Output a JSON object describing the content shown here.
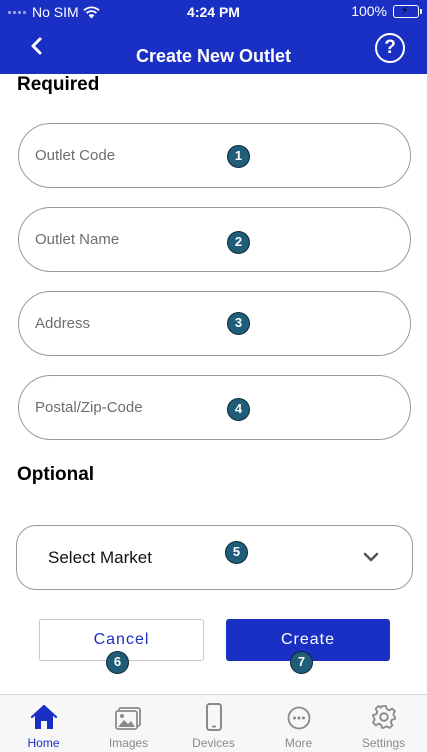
{
  "status_bar": {
    "carrier": "No SIM",
    "time": "4:24 PM",
    "battery": "100%"
  },
  "header": {
    "title": "Create New Outlet",
    "back_icon": "chevron-left-icon",
    "help_icon": "question-circle-icon",
    "help_symbol": "?"
  },
  "required_section": {
    "title": "Required",
    "fields": [
      {
        "placeholder": "Outlet Code",
        "value": "",
        "badge": "1"
      },
      {
        "placeholder": "Outlet Name",
        "value": "",
        "badge": "2"
      },
      {
        "placeholder": "Address",
        "value": "",
        "badge": "3"
      },
      {
        "placeholder": "Postal/Zip-Code",
        "value": "",
        "badge": "4"
      }
    ]
  },
  "optional_section": {
    "title": "Optional",
    "market_select": {
      "label": "Select Market",
      "badge": "5"
    }
  },
  "actions": {
    "cancel_label": "Cancel",
    "cancel_badge": "6",
    "create_label": "Create",
    "create_badge": "7"
  },
  "tabbar": {
    "items": [
      {
        "label": "Home",
        "icon": "home-icon",
        "active": true
      },
      {
        "label": "Images",
        "icon": "images-icon",
        "active": false
      },
      {
        "label": "Devices",
        "icon": "device-icon",
        "active": false
      },
      {
        "label": "More",
        "icon": "more-icon",
        "active": false
      },
      {
        "label": "Settings",
        "icon": "gear-icon",
        "active": false
      }
    ]
  },
  "colors": {
    "brand_blue": "#1a2fc4",
    "badge": "#1f5d78",
    "battery_green": "#4cd964"
  }
}
